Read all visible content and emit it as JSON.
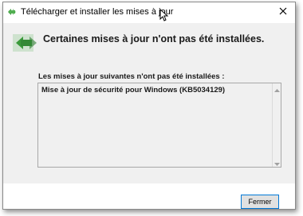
{
  "window": {
    "title": "Télécharger et installer les mises à jour",
    "title_icon": "windows-update-icon",
    "close_icon": "close-icon"
  },
  "content": {
    "header_icon": "windows-update-icon",
    "heading": "Certaines mises à jour n'ont pas été installées.",
    "list_label": "Les mises à jour suivantes n'ont pas été installées :",
    "list_items": [
      "Mise à jour de sécurité pour Windows (KB5034129)"
    ]
  },
  "footer": {
    "close_button_label": "Fermer"
  },
  "colors": {
    "content_bg": "#f0f0f0",
    "button_border": "#0078d7",
    "icon_green": "#3a9a3a"
  }
}
